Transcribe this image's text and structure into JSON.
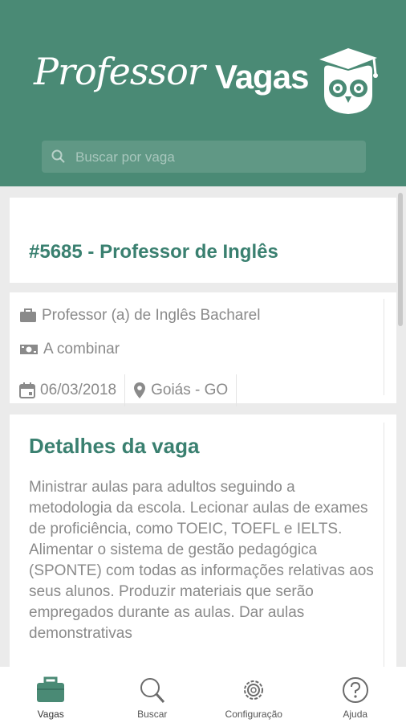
{
  "app": {
    "logo_script": "Professor",
    "logo_bold": "Vagas",
    "brand_color": "#4a8a75",
    "accent_text_color": "#3a8070"
  },
  "search": {
    "placeholder": "Buscar por vaga",
    "icon": "search-icon"
  },
  "job": {
    "title": "#5685 - Professor de Inglês",
    "position": "Professor (a) de Inglês Bacharel",
    "salary": "A combinar",
    "date": "06/03/2018",
    "location": "Goiás - GO",
    "icons": {
      "position": "briefcase-icon",
      "salary": "money-icon",
      "date": "calendar-icon",
      "location": "location-pin-icon"
    }
  },
  "details": {
    "heading": "Detalhes da vaga",
    "body": "Ministrar aulas para adultos seguindo a metodologia da escola. Lecionar aulas de exames de proficiência, como TOEIC, TOEFL e IELTS. Alimentar o sistema de gestão pedagógica (SPONTE) com todas as informações relativas aos seus alunos. Produzir materiais que serão empregados durante as aulas. Dar aulas demonstrativas"
  },
  "bottom_nav": {
    "items": [
      {
        "label": "Vagas",
        "icon": "briefcase-icon",
        "active": true
      },
      {
        "label": "Buscar",
        "icon": "search-icon",
        "active": false
      },
      {
        "label": "Configuração",
        "icon": "gear-icon",
        "active": false
      },
      {
        "label": "Ajuda",
        "icon": "help-icon",
        "active": false
      }
    ]
  }
}
